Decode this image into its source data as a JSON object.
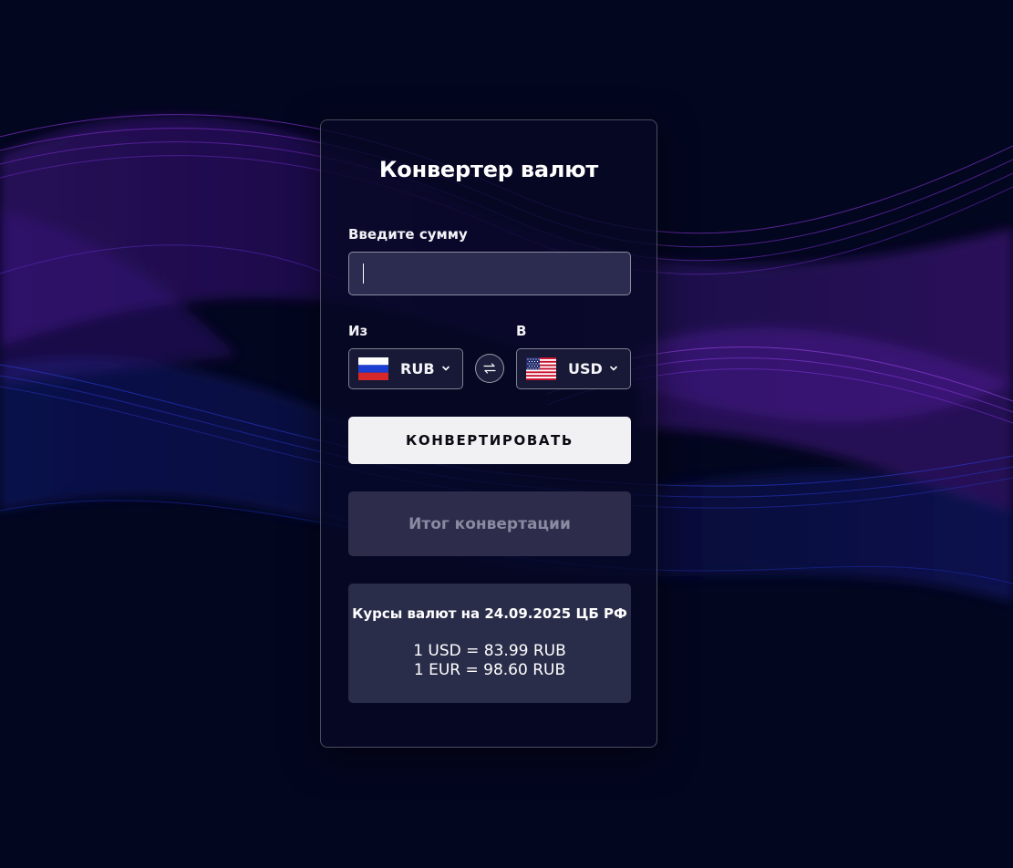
{
  "converter": {
    "title": "Конвертер валют",
    "amount_label": "Введите сумму",
    "amount_value": "",
    "from_label": "Из",
    "to_label": "В",
    "from_currency": "RUB",
    "to_currency": "USD",
    "from_flag": "russia-flag-icon",
    "to_flag": "usa-flag-icon",
    "swap_icon": "swap-arrows-icon",
    "convert_label": "КОНВЕРТИРОВАТЬ",
    "result_placeholder": "Итог конвертации"
  },
  "rates": {
    "title": "Курсы валют на 24.09.2025 ЦБ РФ",
    "lines": [
      "1 USD = 83.99 RUB",
      "1 EUR = 98.60 RUB"
    ]
  },
  "colors": {
    "background": "#03061f",
    "wave_purple": "#7a22c9",
    "wave_blue": "#2a34d8",
    "button_bg": "#f1f1f3",
    "panel_bg": "#2a2d4a"
  }
}
